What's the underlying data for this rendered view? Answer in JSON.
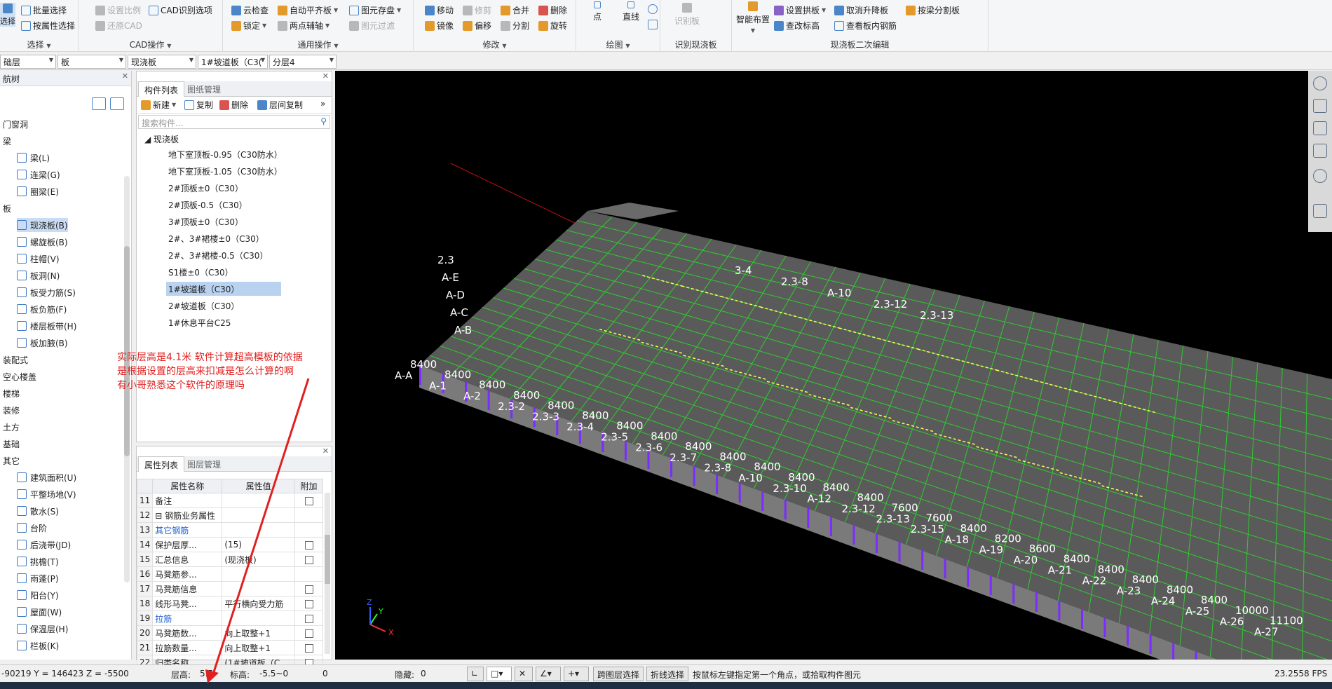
{
  "ribbon": {
    "groups": [
      {
        "title": "选择",
        "buttons": [
          "选择",
          "批量选择",
          "按属性选择"
        ]
      },
      {
        "title": "CAD操作",
        "buttons": [
          "设置比例",
          "CAD识别选项",
          "还原CAD"
        ]
      },
      {
        "title": "通用操作",
        "buttons": [
          "云检查",
          "自动平齐板",
          "图元存盘",
          "锁定",
          "两点辅轴",
          "图元过滤"
        ]
      },
      {
        "title": "修改",
        "buttons": [
          "移动",
          "修剪",
          "合并",
          "删除",
          "镜像",
          "偏移",
          "分割",
          "旋转"
        ]
      },
      {
        "title": "绘图",
        "buttons": [
          "点",
          "直线"
        ]
      },
      {
        "title": "识别现浇板",
        "buttons": [
          "识别板"
        ]
      },
      {
        "title": "现浇板二次编辑",
        "buttons": [
          "智能布置",
          "设置拱板",
          "取消升降板",
          "按梁分割板",
          "查改标高",
          "查看板内钢筋"
        ]
      }
    ]
  },
  "filters": {
    "floor": "础层",
    "type": "板",
    "subtype": "现浇板",
    "component": "1#坡道板（C3(",
    "layer": "分层4"
  },
  "navtree": {
    "title": "航树",
    "items": [
      {
        "label": "门窗洞",
        "level": "cat"
      },
      {
        "label": "梁",
        "level": "cat"
      },
      {
        "label": "梁(L)",
        "level": "sub"
      },
      {
        "label": "连梁(G)",
        "level": "sub"
      },
      {
        "label": "圈梁(E)",
        "level": "sub"
      },
      {
        "label": "板",
        "level": "cat"
      },
      {
        "label": "现浇板(B)",
        "level": "sub",
        "selected": true
      },
      {
        "label": "螺旋板(B)",
        "level": "sub"
      },
      {
        "label": "柱帽(V)",
        "level": "sub"
      },
      {
        "label": "板洞(N)",
        "level": "sub"
      },
      {
        "label": "板受力筋(S)",
        "level": "sub"
      },
      {
        "label": "板负筋(F)",
        "level": "sub"
      },
      {
        "label": "楼层板带(H)",
        "level": "sub"
      },
      {
        "label": "板加腋(B)",
        "level": "sub"
      },
      {
        "label": "装配式",
        "level": "cat"
      },
      {
        "label": "空心楼盖",
        "level": "cat"
      },
      {
        "label": "楼梯",
        "level": "cat"
      },
      {
        "label": "装修",
        "level": "cat"
      },
      {
        "label": "土方",
        "level": "cat"
      },
      {
        "label": "基础",
        "level": "cat"
      },
      {
        "label": "其它",
        "level": "cat"
      },
      {
        "label": "建筑面积(U)",
        "level": "sub"
      },
      {
        "label": "平整场地(V)",
        "level": "sub"
      },
      {
        "label": "散水(S)",
        "level": "sub"
      },
      {
        "label": "台阶",
        "level": "sub"
      },
      {
        "label": "后浇带(JD)",
        "level": "sub"
      },
      {
        "label": "挑檐(T)",
        "level": "sub"
      },
      {
        "label": "雨蓬(P)",
        "level": "sub"
      },
      {
        "label": "阳台(Y)",
        "level": "sub"
      },
      {
        "label": "屋面(W)",
        "level": "sub"
      },
      {
        "label": "保温层(H)",
        "level": "sub"
      },
      {
        "label": "栏板(K)",
        "level": "sub"
      }
    ]
  },
  "complist": {
    "tab_active": "构件列表",
    "tab_inactive": "图纸管理",
    "toolbar": [
      "新建",
      "复制",
      "删除",
      "层间复制"
    ],
    "search_placeholder": "搜索构件...",
    "root": "现浇板",
    "items": [
      {
        "label": "地下室顶板-0.95（C30防水）"
      },
      {
        "label": "地下室顶板-1.05（C30防水）"
      },
      {
        "label": "2#顶板±0（C30）"
      },
      {
        "label": "2#顶板-0.5（C30）"
      },
      {
        "label": "3#顶板±0（C30）"
      },
      {
        "label": "2#、3#裙楼±0（C30）"
      },
      {
        "label": "2#、3#裙楼-0.5（C30）"
      },
      {
        "label": "S1楼±0（C30）"
      },
      {
        "label": "1#坡道板（C30）",
        "selected": true
      },
      {
        "label": "2#坡道板（C30）"
      },
      {
        "label": "1#休息平台C25"
      }
    ]
  },
  "proplist": {
    "tab_active": "属性列表",
    "tab_inactive": "图层管理",
    "headers": [
      "属性名称",
      "属性值",
      "附加"
    ],
    "rows": [
      {
        "num": "11",
        "name": "备注",
        "value": "",
        "check": true
      },
      {
        "num": "12",
        "name": "⊟ 钢筋业务属性",
        "value": "",
        "check": false
      },
      {
        "num": "13",
        "name": "其它钢筋",
        "value": "",
        "check": false,
        "blue": true
      },
      {
        "num": "14",
        "name": "保护层厚...",
        "value": "(15)",
        "check": true
      },
      {
        "num": "15",
        "name": "汇总信息",
        "value": "(现浇板)",
        "check": true
      },
      {
        "num": "16",
        "name": "马凳筋参...",
        "value": "",
        "check": false
      },
      {
        "num": "17",
        "name": "马凳筋信息",
        "value": "",
        "check": true
      },
      {
        "num": "18",
        "name": "线形马凳...",
        "value": "平行横向受力筋",
        "check": true
      },
      {
        "num": "19",
        "name": "拉筋",
        "value": "",
        "check": true,
        "blue": true
      },
      {
        "num": "20",
        "name": "马凳筋数...",
        "value": "向上取整+1",
        "check": true
      },
      {
        "num": "21",
        "name": "拉筋数量...",
        "value": "向上取整+1",
        "check": true
      },
      {
        "num": "22",
        "name": "归类名称",
        "value": "(1#坡道板（C...",
        "check": true
      }
    ]
  },
  "annotation": {
    "line1": "实际层高是4.1米  软件计算超高模板的依据",
    "line2": "是根据设置的层高来扣减是怎么计算的啊",
    "line3": "有小哥熟悉这个软件的原理吗"
  },
  "viewport": {
    "axis_labels_left": [
      "A-A",
      "A-1",
      "A-2",
      "2.3-2",
      "2.3-3",
      "2.3-4",
      "2.3-5",
      "2.3-6",
      "2.3-7",
      "2.3-8",
      "A-10",
      "2.3-10",
      "A-12",
      "2.3-12",
      "2.3-13",
      "2.3-15",
      "A-18",
      "A-19",
      "A-20",
      "A-21",
      "A-22",
      "A-23",
      "A-24",
      "A-25",
      "A-26",
      "A-27"
    ],
    "axis_labels_top": [
      "A-B",
      "A-C",
      "A-D",
      "A-E",
      "2.3",
      "3-4",
      "2.3-8",
      "A-10",
      "2.3-12",
      "2.3-13"
    ],
    "spacings": [
      "8400",
      "8400",
      "8400",
      "8400",
      "8400",
      "8400",
      "8400",
      "8400",
      "8400",
      "8400",
      "8400",
      "8400",
      "8400",
      "8400",
      "7600",
      "7600",
      "8400",
      "8200",
      "8600",
      "8400",
      "8400",
      "8400",
      "8400",
      "8400",
      "10000",
      "11100"
    ],
    "fps": "23.2558 FPS",
    "colors": {
      "slab": "#5a5a5a",
      "grid": "#2ecc2e",
      "rebar": "#ffff55",
      "column": "#7b2cff",
      "bg": "#000000"
    }
  },
  "status": {
    "coords": "-90219 Y = 146423 Z = -5500",
    "floor_height_label": "层高:",
    "floor_height": "5.5",
    "elev_label": "标高:",
    "elev": "-5.5~0",
    "zero": "0",
    "hidden_label": "隐藏:",
    "hidden": "0",
    "btn_cross": "跨图层选择",
    "btn_polyline": "折线选择",
    "hint": "按鼠标左键指定第一个角点，或拾取构件图元",
    "fps": "23.2558 FPS"
  }
}
